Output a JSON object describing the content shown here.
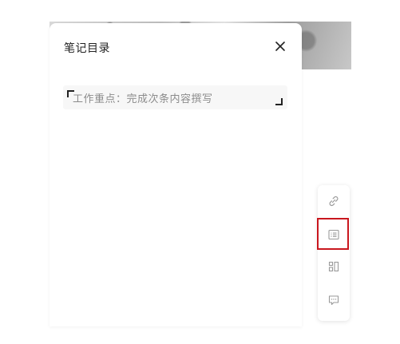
{
  "panel": {
    "title": "笔记目录",
    "close_icon": "close-icon",
    "toc_items": [
      {
        "label": "工作重点：完成次条内容撰写"
      }
    ]
  },
  "toolbar": {
    "buttons": [
      {
        "icon": "link-icon"
      },
      {
        "icon": "list-icon",
        "highlighted": true
      },
      {
        "icon": "layout-icon"
      },
      {
        "icon": "comment-icon"
      }
    ],
    "highlight_color": "#c9171e"
  }
}
